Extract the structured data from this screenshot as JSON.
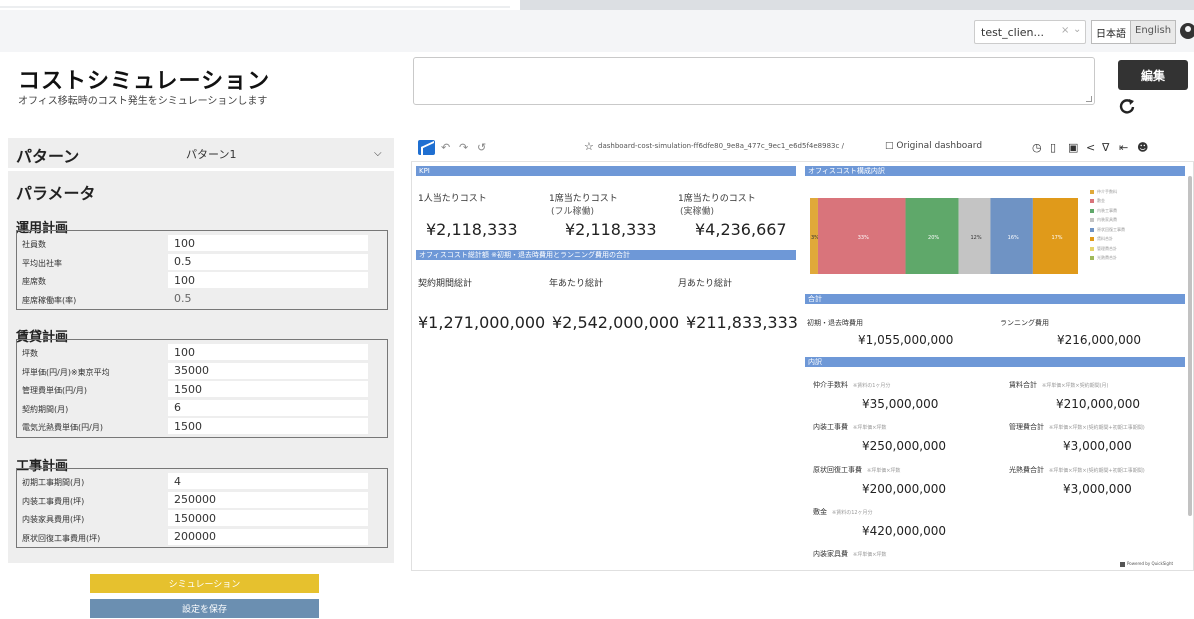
{
  "header": {
    "client_selector": "test_clien...",
    "clear_glyph": "×",
    "dropdown_glyph": "⌄",
    "lang_ja": "日本語",
    "lang_en": "English"
  },
  "page": {
    "title": "コストシミュレーション",
    "subtitle": "オフィス移転時のコスト発生をシミュレーションします"
  },
  "memo": {
    "value": ""
  },
  "edit_label": "編集",
  "pattern": {
    "label": "パターン",
    "selected": "パターン1"
  },
  "params": {
    "heading": "パラメータ",
    "sections": [
      {
        "title": "運用計画",
        "fields": [
          {
            "label": "社員数",
            "value": "100"
          },
          {
            "label": "平均出社率",
            "value": "0.5"
          },
          {
            "label": "座席数",
            "value": "100"
          },
          {
            "label": "座席稼働率(率)",
            "value": "0.5"
          }
        ]
      },
      {
        "title": "賃貸計画",
        "fields": [
          {
            "label": "坪数",
            "value": "100"
          },
          {
            "label": "坪単価(円/月)※東京平均",
            "value": "35000"
          },
          {
            "label": "管理費単価(円/月)",
            "value": "1500"
          },
          {
            "label": "契約期間(月)",
            "value": "6"
          },
          {
            "label": "電気光熱費単価(円/月)",
            "value": "1500"
          }
        ]
      },
      {
        "title": "工事計画",
        "fields": [
          {
            "label": "初期工事期間(月)",
            "value": "4"
          },
          {
            "label": "内装工事費用(坪)",
            "value": "250000"
          },
          {
            "label": "内装家具費用(坪)",
            "value": "150000"
          },
          {
            "label": "原状回復工事費用(坪)",
            "value": "200000"
          }
        ]
      }
    ]
  },
  "buttons": {
    "simulate": "シミュレーション",
    "save": "設定を保存"
  },
  "dashboard": {
    "path": "dashboard-cost-simulation-ff6dfe80_9e8a_477c_9ec1_e6d5f4e8983c /",
    "title": "Original dashboard",
    "kpi_band": "KPI",
    "kpi": [
      {
        "label": "1人当たりコスト",
        "sub": "",
        "value": "¥2,118,333"
      },
      {
        "label": "1席当たりコスト",
        "sub": "(フル稼働)",
        "value": "¥2,118,333"
      },
      {
        "label": "1席当たりのコスト",
        "sub": "(実稼働)",
        "value": "¥4,236,667"
      }
    ],
    "total_band": "オフィスコスト総計額 ※初期・退去時費用とランニング費用の合計",
    "totals": [
      {
        "label": "契約期間総計",
        "value": "¥1,271,000,000"
      },
      {
        "label": "年あたり総計",
        "value": "¥2,542,000,000"
      },
      {
        "label": "月あたり総計",
        "value": "¥211,833,333"
      }
    ],
    "breakdown_band": "オフィスコスト構成内訳",
    "sum_band": "合計",
    "sum": [
      {
        "label": "初期・退去時費用",
        "value": "¥1,055,000,000"
      },
      {
        "label": "ランニング費用",
        "value": "¥216,000,000"
      }
    ],
    "detail_band": "内訳",
    "details": [
      {
        "label": "仲介手数料",
        "note": "※賃料の1ヶ月分",
        "value": "¥35,000,000"
      },
      {
        "label": "賃料合計",
        "note": "※坪単価×坪数×契約期間(月)",
        "value": "¥210,000,000"
      },
      {
        "label": "内装工事費",
        "note": "※坪単価×坪数",
        "value": "¥250,000,000"
      },
      {
        "label": "管理費合計",
        "note": "※坪単価×坪数×(契約期間+初期工事期間)",
        "value": "¥3,000,000"
      },
      {
        "label": "原状回復工事費",
        "note": "※坪単価×坪数",
        "value": "¥200,000,000"
      },
      {
        "label": "光熱費合計",
        "note": "※坪単価×坪数×(契約期間+初期工事期間)",
        "value": "¥3,000,000"
      },
      {
        "label": "敷金",
        "note": "※賃料の12ヶ月分",
        "value": "¥420,000,000"
      },
      {
        "label": "内装家具費",
        "note": "※坪単価×坪数",
        "value": ""
      }
    ],
    "powered": "Powered by QuickSight"
  },
  "chart_data": {
    "type": "bar",
    "stacked": true,
    "orientation": "horizontal",
    "legend_position": "right",
    "categories": [
      ""
    ],
    "series": [
      {
        "name": "仲介手数料",
        "values": [
          3
        ],
        "color": "#e0a93a",
        "label": "3%"
      },
      {
        "name": "敷金",
        "values": [
          33
        ],
        "color": "#d9747b",
        "label": "33%"
      },
      {
        "name": "内装工事費",
        "values": [
          20
        ],
        "color": "#5fa86a",
        "label": "20%"
      },
      {
        "name": "内装家具費",
        "values": [
          12
        ],
        "color": "#c4c4c4",
        "label": "12%"
      },
      {
        "name": "原状回復工事費",
        "values": [
          16
        ],
        "color": "#6f93c4",
        "label": "16%"
      },
      {
        "name": "賃料合計",
        "values": [
          17
        ],
        "color": "#e09a1a",
        "label": "17%"
      },
      {
        "name": "管理費合計",
        "values": [
          0
        ],
        "color": "#e6d36a",
        "label": ""
      },
      {
        "name": "光熱費合計",
        "values": [
          0
        ],
        "color": "#9fb95a",
        "label": ""
      }
    ]
  }
}
